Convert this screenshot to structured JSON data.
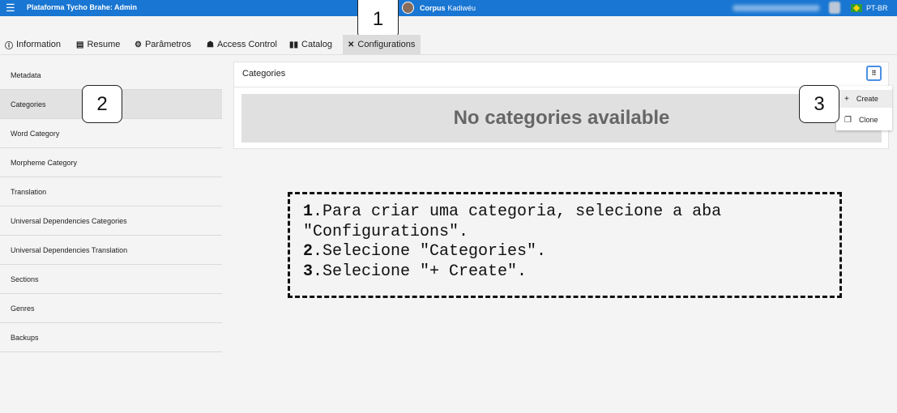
{
  "header": {
    "menu_icon": "hamburger-menu-icon",
    "app_title": "Plataforma Tycho Brahe: Admin",
    "corpus_bold": "Corpus",
    "corpus_name": "Kadiwéu",
    "language": "PT-BR",
    "accent_color": "#1976d2"
  },
  "tabs": [
    {
      "icon": "info-icon",
      "glyph": "ⓘ",
      "label": "Information"
    },
    {
      "icon": "document-icon",
      "glyph": "▤",
      "label": "Resume"
    },
    {
      "icon": "gears-icon",
      "glyph": "⚙",
      "label": "Parâmetros"
    },
    {
      "icon": "users-icon",
      "glyph": "☗",
      "label": "Access Control"
    },
    {
      "icon": "book-icon",
      "glyph": "▮▮",
      "label": "Catalog"
    },
    {
      "icon": "tools-icon",
      "glyph": "✕",
      "label": "Configurations"
    }
  ],
  "sidebar": {
    "items": [
      {
        "label": "Metadata"
      },
      {
        "label": "Categories"
      },
      {
        "label": "Word Category"
      },
      {
        "label": "Morpheme Category"
      },
      {
        "label": "Translation"
      },
      {
        "label": "Universal Dependencies Categories"
      },
      {
        "label": "Universal Dependencies Translation"
      },
      {
        "label": "Sections"
      },
      {
        "label": "Genres"
      },
      {
        "label": "Backups"
      }
    ]
  },
  "main": {
    "card_title": "Categories",
    "empty_message": "No categories available",
    "more_icon": "grid-dots-icon",
    "dropdown": {
      "create_glyph": "+",
      "create_label": "Create",
      "clone_glyph": "❐",
      "clone_label": "Clone"
    }
  },
  "badges": [
    "1",
    "2",
    "3"
  ],
  "instructions": {
    "n1": "1",
    "line1": ".Para criar uma categoria, selecione a aba",
    "line1b": "\"Configurations\".",
    "n2": "2",
    "line2": ".Selecione \"Categories\".",
    "n3": "3",
    "line3": ".Selecione \"+ Create\"."
  }
}
